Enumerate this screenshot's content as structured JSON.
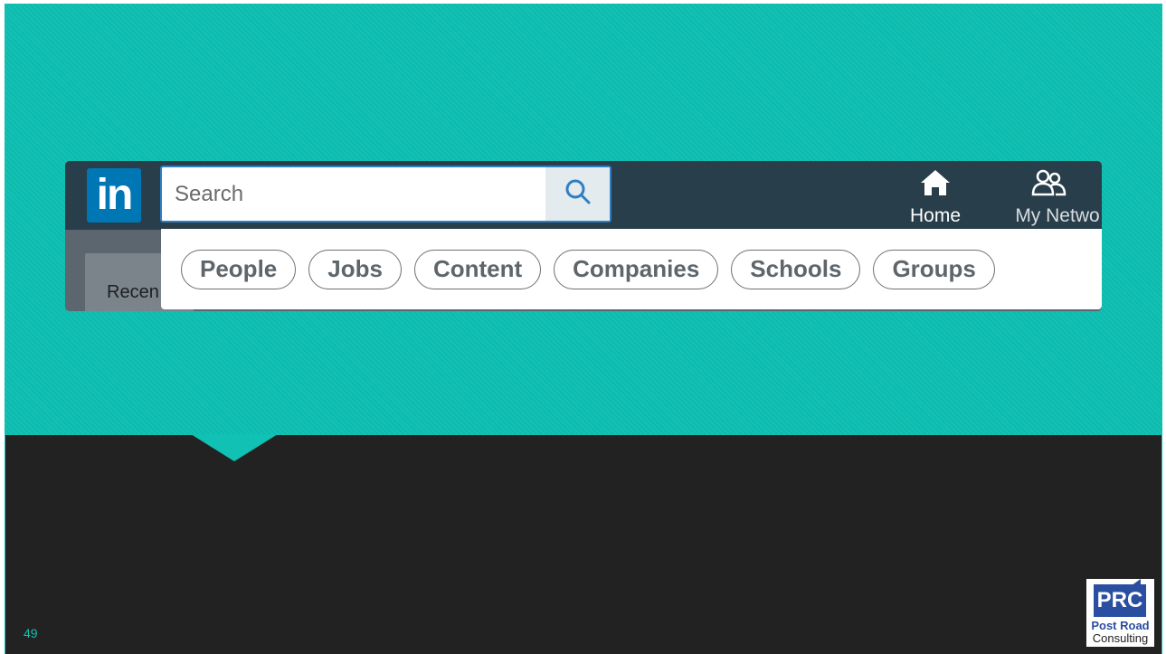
{
  "colors": {
    "teal_background": "#11c1b3",
    "dark_background": "#222222",
    "linkedin_blue": "#0077b5",
    "topbar": "#283e4a",
    "prc_blue": "#2a4ea0"
  },
  "linkedin": {
    "logo_text": "in",
    "search": {
      "placeholder": "Search",
      "button_icon": "search-icon"
    },
    "nav": {
      "home": {
        "label": "Home",
        "icon": "home-icon"
      },
      "network": {
        "label": "My Netwo",
        "icon": "people-icon"
      }
    },
    "filters": [
      "People",
      "Jobs",
      "Content",
      "Companies",
      "Schools",
      "Groups"
    ],
    "background_text": "Recen"
  },
  "slide": {
    "page_number": "49"
  },
  "brand": {
    "badge": "PRC",
    "line1": "Post Road",
    "line2": "Consulting"
  }
}
